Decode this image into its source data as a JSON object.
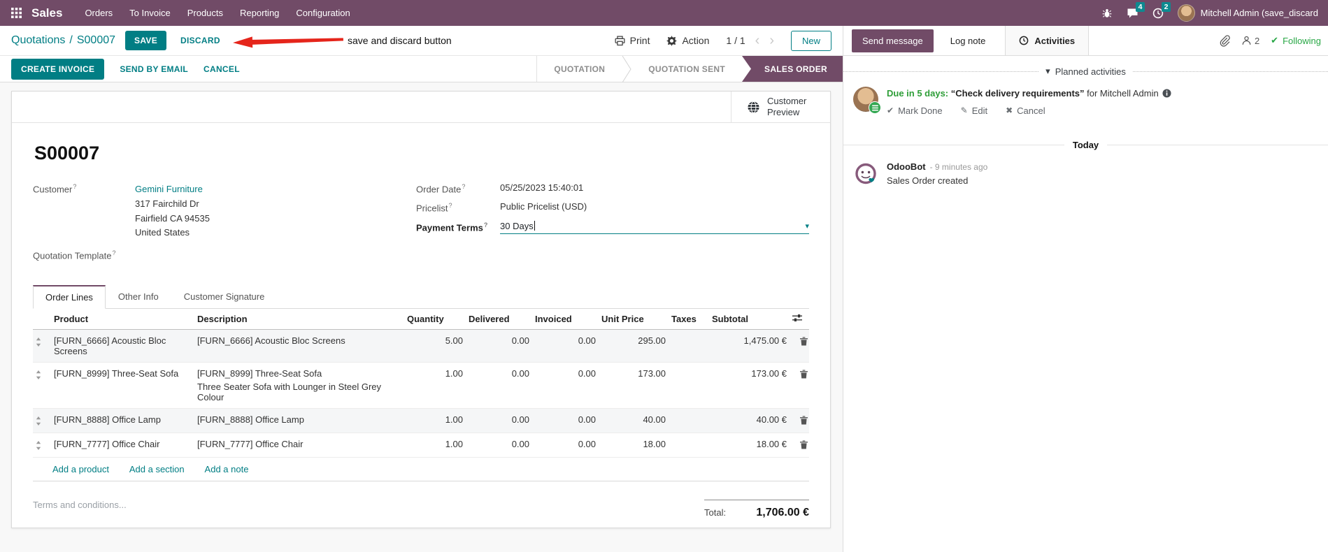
{
  "colors": {
    "brand": "#714B67",
    "accent": "#017e84",
    "success": "#28a745",
    "annotation_red": "#e5251b"
  },
  "icons": {
    "caret_down": "▾",
    "chevron_left": "‹",
    "chevron_right": "›",
    "check": "✔",
    "pencil": "✎",
    "cross": "✖"
  },
  "hint_mark": "?",
  "topbar": {
    "app": "Sales",
    "menus": [
      "Orders",
      "To Invoice",
      "Products",
      "Reporting",
      "Configuration"
    ],
    "messages_badge": "4",
    "activities_badge": "2",
    "user": "Mitchell Admin (save_discard"
  },
  "control": {
    "breadcrumb_parent": "Quotations",
    "breadcrumb_sep": "/",
    "breadcrumb_current": "S00007",
    "save": "SAVE",
    "discard": "DISCARD",
    "annotation": "save and discard button",
    "print": "Print",
    "action": "Action",
    "pager": "1 / 1",
    "new": "New"
  },
  "statusbar": {
    "create_invoice": "CREATE INVOICE",
    "send_by_email": "SEND BY EMAIL",
    "cancel": "CANCEL",
    "stages": [
      "QUOTATION",
      "QUOTATION SENT",
      "SALES ORDER"
    ]
  },
  "sheet": {
    "customer_preview": "Customer Preview",
    "title": "S00007",
    "fields": {
      "customer": {
        "label": "Customer",
        "name": "Gemini Furniture",
        "address1": "317 Fairchild Dr",
        "address2": "Fairfield CA 94535",
        "address3": "United States"
      },
      "quotation_template": {
        "label": "Quotation Template"
      },
      "order_date": {
        "label": "Order Date",
        "value": "05/25/2023 15:40:01"
      },
      "pricelist": {
        "label": "Pricelist",
        "value": "Public Pricelist (USD)"
      },
      "payment_terms": {
        "label": "Payment Terms",
        "value": "30 Days"
      }
    },
    "tabs": [
      "Order Lines",
      "Other Info",
      "Customer Signature"
    ],
    "table": {
      "headers": {
        "product": "Product",
        "description": "Description",
        "quantity": "Quantity",
        "delivered": "Delivered",
        "invoiced": "Invoiced",
        "unit_price": "Unit Price",
        "taxes": "Taxes",
        "subtotal": "Subtotal"
      },
      "lines": [
        {
          "product": "[FURN_6666] Acoustic Bloc Screens",
          "description": "[FURN_6666] Acoustic Bloc Screens",
          "description2": "",
          "quantity": "5.00",
          "delivered": "0.00",
          "invoiced": "0.00",
          "unit_price": "295.00",
          "taxes": "",
          "subtotal": "1,475.00 €"
        },
        {
          "product": "[FURN_8999] Three-Seat Sofa",
          "description": "[FURN_8999] Three-Seat Sofa",
          "description2": "Three Seater Sofa with Lounger in Steel Grey Colour",
          "quantity": "1.00",
          "delivered": "0.00",
          "invoiced": "0.00",
          "unit_price": "173.00",
          "taxes": "",
          "subtotal": "173.00 €"
        },
        {
          "product": "[FURN_8888] Office Lamp",
          "description": "[FURN_8888] Office Lamp",
          "description2": "",
          "quantity": "1.00",
          "delivered": "0.00",
          "invoiced": "0.00",
          "unit_price": "40.00",
          "taxes": "",
          "subtotal": "40.00 €"
        },
        {
          "product": "[FURN_7777] Office Chair",
          "description": "[FURN_7777] Office Chair",
          "description2": "",
          "quantity": "1.00",
          "delivered": "0.00",
          "invoiced": "0.00",
          "unit_price": "18.00",
          "taxes": "",
          "subtotal": "18.00 €"
        }
      ],
      "links": [
        "Add a product",
        "Add a section",
        "Add a note"
      ]
    },
    "terms_placeholder": "Terms and conditions...",
    "total_label": "Total:",
    "total_value": "1,706.00 €"
  },
  "chatter": {
    "send_message": "Send message",
    "log_note": "Log note",
    "activities": "Activities",
    "followers_count": "2",
    "following": "Following",
    "planned_header": "Planned activities",
    "activity": {
      "due": "Due in 5 days:",
      "title": "“Check delivery requirements”",
      "for_text": "for Mitchell Admin",
      "mark_done": "Mark Done",
      "edit": "Edit",
      "cancel": "Cancel"
    },
    "today": "Today",
    "message": {
      "author": "OdooBot",
      "time": "- 9 minutes ago",
      "body": "Sales Order created"
    }
  }
}
